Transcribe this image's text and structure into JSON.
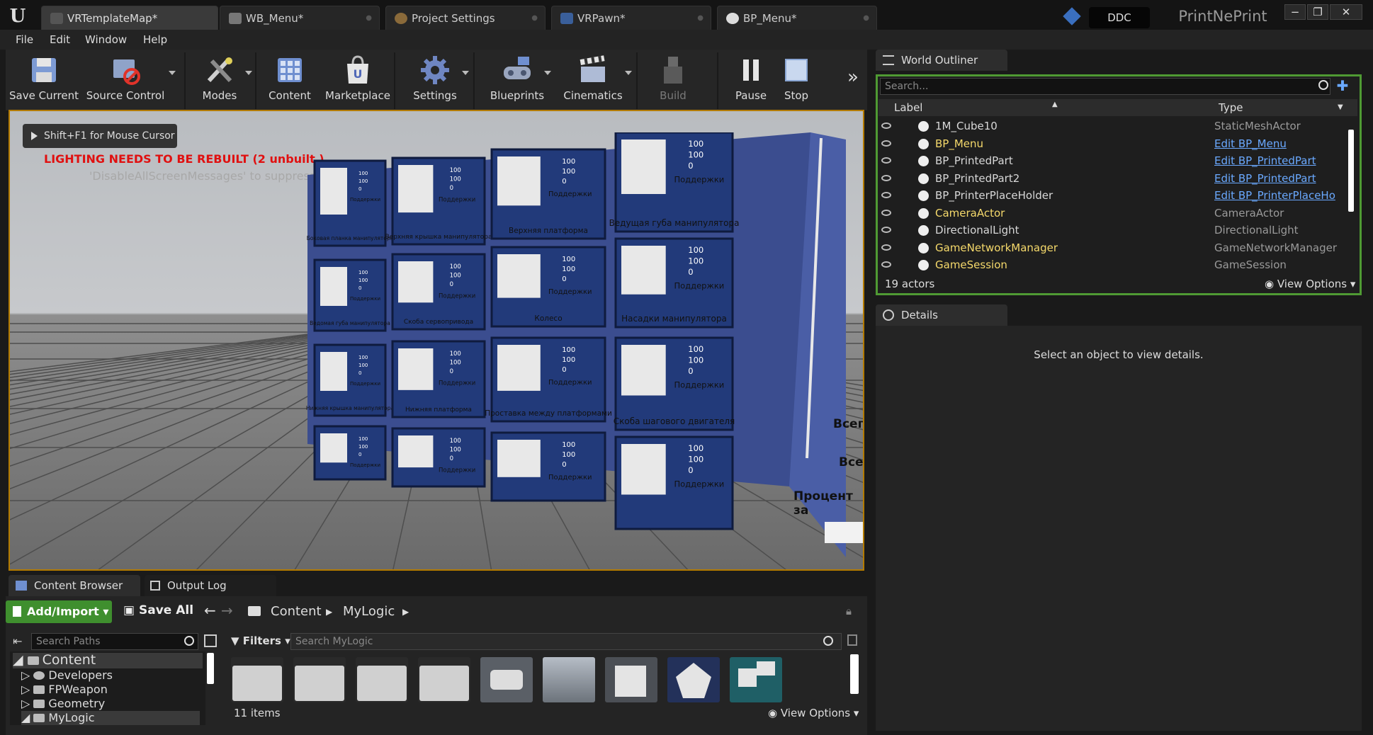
{
  "tabs": [
    {
      "label": "VRTemplateMap*"
    },
    {
      "label": "WB_Menu*"
    },
    {
      "label": "Project Settings"
    },
    {
      "label": "VRPawn*"
    },
    {
      "label": "BP_Menu*"
    }
  ],
  "topbar": {
    "ddc": "DDC",
    "project": "PrintNePrint"
  },
  "menu": [
    "File",
    "Edit",
    "Window",
    "Help"
  ],
  "toolbar": [
    "Save Current",
    "Source Control",
    "Modes",
    "Content",
    "Marketplace",
    "Settings",
    "Blueprints",
    "Cinematics",
    "Build",
    "Pause",
    "Stop"
  ],
  "viewport": {
    "hint": "Shift+F1 for Mouse Cursor",
    "warning": "LIGHTING NEEDS TO BE REBUILT (2 unbuilt )",
    "warning2": "'DisableAllScreenMessages' to suppress",
    "board_values": [
      "100",
      "100",
      "0"
    ],
    "board_check": "Поддержки",
    "parts": [
      "Боковая планка манипулятора",
      "Верхняя крышка манипулятора",
      "Верхняя платформа",
      "Ведущая губа манипулятора",
      "Ведомая губа манипулятора",
      "Скоба сервопривода",
      "Колесо",
      "Насадки манипулятора",
      "Нижняя крышка манипулятора",
      "Нижняя платформа",
      "Проставка между платформами",
      "Скоба шагового двигателя",
      "",
      "",
      "",
      ""
    ],
    "side": [
      "Всего",
      "Всего",
      "Процент за"
    ]
  },
  "outliner": {
    "title": "World Outliner",
    "search_placeholder": "Search...",
    "col_label": "Label",
    "col_type": "Type",
    "rows": [
      {
        "label": "1M_Cube10",
        "type": "StaticMeshActor",
        "lc": "white",
        "tc": "grey"
      },
      {
        "label": "BP_Menu",
        "type": "Edit BP_Menu",
        "lc": "yellow",
        "tc": "link"
      },
      {
        "label": "BP_PrintedPart",
        "type": "Edit BP_PrintedPart",
        "lc": "white",
        "tc": "link"
      },
      {
        "label": "BP_PrintedPart2",
        "type": "Edit BP_PrintedPart",
        "lc": "white",
        "tc": "link"
      },
      {
        "label": "BP_PrinterPlaceHolder",
        "type": "Edit BP_PrinterPlaceHo",
        "lc": "white",
        "tc": "link"
      },
      {
        "label": "CameraActor",
        "type": "CameraActor",
        "lc": "yellow",
        "tc": "grey"
      },
      {
        "label": "DirectionalLight",
        "type": "DirectionalLight",
        "lc": "white",
        "tc": "grey"
      },
      {
        "label": "GameNetworkManager",
        "type": "GameNetworkManager",
        "lc": "yellow",
        "tc": "grey"
      },
      {
        "label": "GameSession",
        "type": "GameSession",
        "lc": "yellow",
        "tc": "grey"
      }
    ],
    "count": "19 actors",
    "view_options": "View Options"
  },
  "details": {
    "title": "Details",
    "empty": "Select an object to view details."
  },
  "content_browser": {
    "tab": "Content Browser",
    "tab2": "Output Log",
    "add_import": "Add/Import",
    "save_all": "Save All",
    "path": [
      "Content",
      "MyLogic"
    ],
    "search_paths": "Search Paths",
    "filters": "Filters",
    "search_assets": "Search MyLogic",
    "tree": [
      "Content",
      "Developers",
      "FPWeapon",
      "Geometry",
      "MyLogic"
    ],
    "count": "11 items",
    "view_options": "View Options"
  }
}
